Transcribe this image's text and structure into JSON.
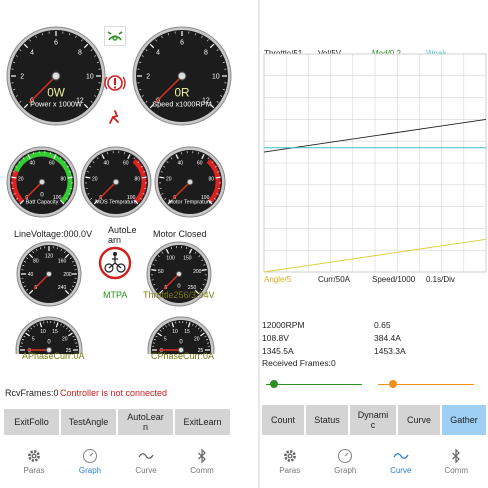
{
  "left": {
    "gauges_top": [
      {
        "value": "0W",
        "caption": "Power x 1000W",
        "ticks": [
          "0",
          "2",
          "4",
          "6",
          "8",
          "10",
          "12"
        ]
      },
      {
        "value": "0R",
        "caption": "Speed x1000RPM",
        "ticks": [
          "0",
          "2",
          "4",
          "6",
          "8",
          "10",
          "12"
        ]
      }
    ],
    "batt": {
      "caption": "Batt Capacity",
      "value": "0",
      "ticks": [
        "0",
        "20",
        "40",
        "60",
        "80",
        "100"
      ]
    },
    "mos": {
      "caption": "MOS Temprature",
      "ticks": [
        "0",
        "20",
        "40",
        "60",
        "80",
        "100"
      ]
    },
    "motor_temp": {
      "caption": "Motor Temprature",
      "ticks": [
        "0",
        "20",
        "40",
        "60",
        "80",
        "100"
      ]
    },
    "line_voltage": "LineVoltage:000.0V",
    "auto_learn": "AutoLearn",
    "motor_closed": "Motor Closed",
    "bus_current": {
      "value": "0A",
      "ticks": [
        "0",
        "40",
        "80",
        "120",
        "160",
        "200",
        "240"
      ]
    },
    "mtpa": "MTPA",
    "throttle": {
      "label": "Throttle256/3.94V",
      "value": "0"
    },
    "phase_a": {
      "label": "APhaseCurr:0A",
      "value": "0"
    },
    "phase_c": {
      "label": "CPhaseCurr:0A",
      "value": "0"
    },
    "rcv_frames": "RcvFrames:0",
    "status": "Controller is not connected",
    "buttons": [
      "ExitFollo",
      "TestAngle",
      "AutoLear\nn",
      "ExitLearn"
    ],
    "nav": [
      {
        "label": "Paras",
        "icon": "gear-icon"
      },
      {
        "label": "Graph",
        "icon": "speedometer-icon"
      },
      {
        "label": "Curve",
        "icon": "wave-icon"
      },
      {
        "label": "Comm",
        "icon": "bluetooth-icon"
      }
    ],
    "active_nav": 1
  },
  "right": {
    "chart_data": {
      "type": "line",
      "legend_top": [
        "Throttle/51",
        "Vol/5V",
        "Mod/0.2",
        "Weak"
      ],
      "legend_bottom": [
        "Angle/5",
        "Curr/50A",
        "Speed/1000",
        "0.1s/Div"
      ],
      "grid": true,
      "colors": {
        "Throttle": "#222222",
        "Vol": "#222222",
        "Mod": "#2d8f22",
        "Weak": "#3fbfd0",
        "Angle": "#d8d040"
      },
      "series": [
        {
          "name": "Throttle/51",
          "y_start": 0.55,
          "y_end": 0.7
        },
        {
          "name": "Weak",
          "y_start": 0.57,
          "y_end": 0.57
        },
        {
          "name": "Angle/5",
          "y_start": 0.0,
          "y_end": 0.15
        }
      ]
    },
    "readouts": [
      [
        "12000RPM",
        "0.65"
      ],
      [
        "108.8V",
        "384.4A"
      ],
      [
        "1345.5A",
        "1453.3A"
      ]
    ],
    "received_frames": "Received Frames:0",
    "sliders": [
      {
        "color": "#2d8f22",
        "value": 0.05
      },
      {
        "color": "#f0901a",
        "value": 0.13
      }
    ],
    "buttons": [
      "Count",
      "Status",
      "Dynami\nc",
      "Curve",
      "Gather"
    ],
    "active_button": 4,
    "nav": [
      {
        "label": "Paras",
        "icon": "gear-icon"
      },
      {
        "label": "Graph",
        "icon": "speedometer-icon"
      },
      {
        "label": "Curve",
        "icon": "wave-icon"
      },
      {
        "label": "Comm",
        "icon": "bluetooth-icon"
      }
    ],
    "active_nav": 2
  }
}
